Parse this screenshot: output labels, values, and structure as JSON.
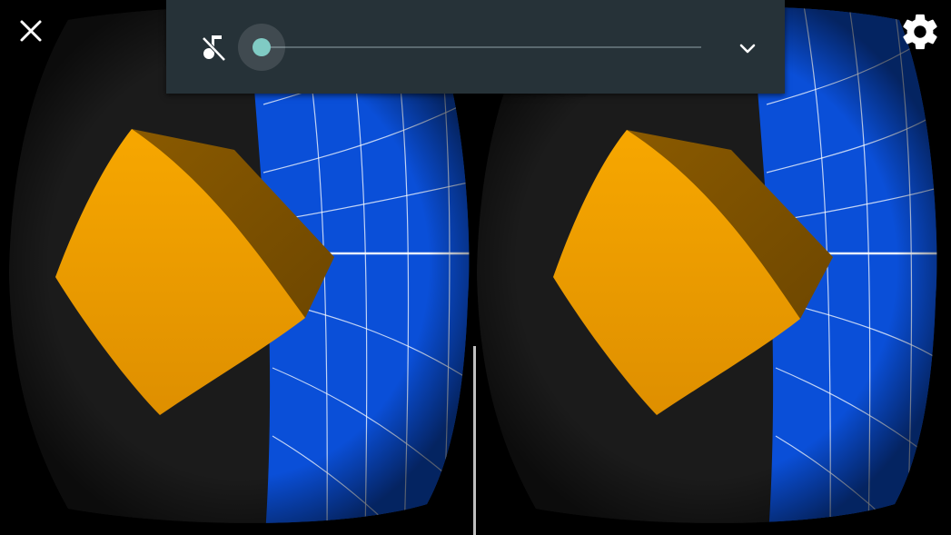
{
  "viewer": {
    "colors": {
      "lens_surround": "#1b1b1b",
      "globe_blue": "#0a4fd8",
      "grid_line": "#ffffff",
      "cube_front": "#f3a000",
      "cube_side": "#7f5200",
      "divider": "#bfbfbf"
    }
  },
  "controls": {
    "close_icon": "close-icon",
    "settings_icon": "gear-icon"
  },
  "audio_panel": {
    "background": "#263238",
    "mute_icon": "music-off-icon",
    "volume_level": 0.0,
    "accent_color": "#80cbc4",
    "expand_icon": "chevron-down-icon"
  }
}
